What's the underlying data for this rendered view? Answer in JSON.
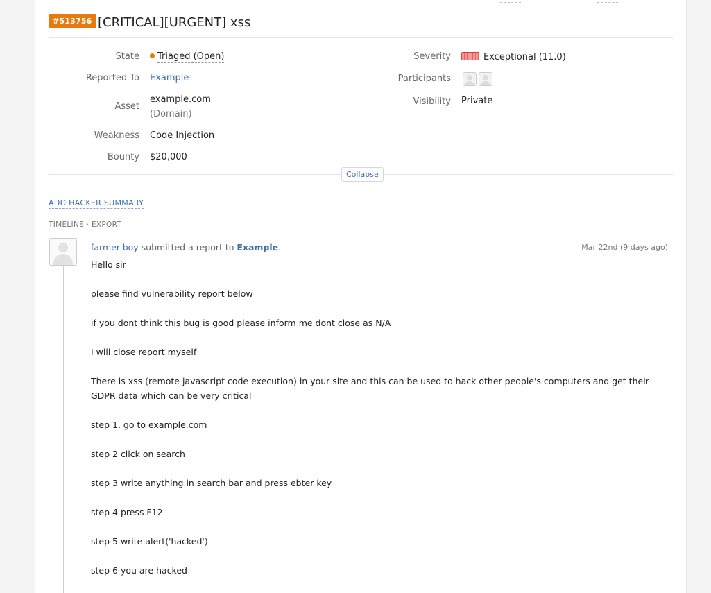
{
  "report": {
    "id": "#513756",
    "title": "[CRITICAL][URGENT] xss"
  },
  "fields": {
    "state_label": "State",
    "state_value": "Triaged (Open)",
    "reported_to_label": "Reported To",
    "reported_to_value": "Example",
    "asset_label": "Asset",
    "asset_value": "example.com",
    "asset_type": "(Domain)",
    "weakness_label": "Weakness",
    "weakness_value": "Code Injection",
    "bounty_label": "Bounty",
    "bounty_value": "$20,000",
    "severity_label": "Severity",
    "severity_value": "Exceptional (11.0)",
    "participants_label": "Participants",
    "visibility_label": "Visibility",
    "visibility_value": "Private"
  },
  "colors": {
    "state_dot": "#e8790d",
    "report_badge": "#e8790d",
    "severity": "#e86060",
    "link": "#3d6fa8"
  },
  "actions": {
    "collapse": "Collapse",
    "add_summary": "ADD HACKER SUMMARY"
  },
  "timeline": {
    "label": "TIMELINE · EXPORT"
  },
  "post": {
    "author": "farmer-boy",
    "action_text": " submitted a report to ",
    "program": "Example",
    "date": "Mar 22nd (9 days ago)",
    "lines": [
      "Hello sir",
      "please find vulnerability report below",
      "if you dont think this bug is good please inform me dont close as N/A",
      "I will close report myself",
      "There is xss (remote javascript code execution) in your site and this can be used to hack other people's computers and get their GDPR data which can be very critical",
      "step 1. go to example.com",
      "step 2 click on search",
      "step 3 write anything in search bar and press ebter key",
      "step 4 press F12",
      "step 5 write alert('hacked')",
      "step 6 you are hacked"
    ]
  },
  "icons": {
    "avatar": "user-avatar-icon",
    "participant": "participant-avatar-icon",
    "state_dot": "status-dot-icon",
    "severity_bar": "severity-bar-icon"
  }
}
